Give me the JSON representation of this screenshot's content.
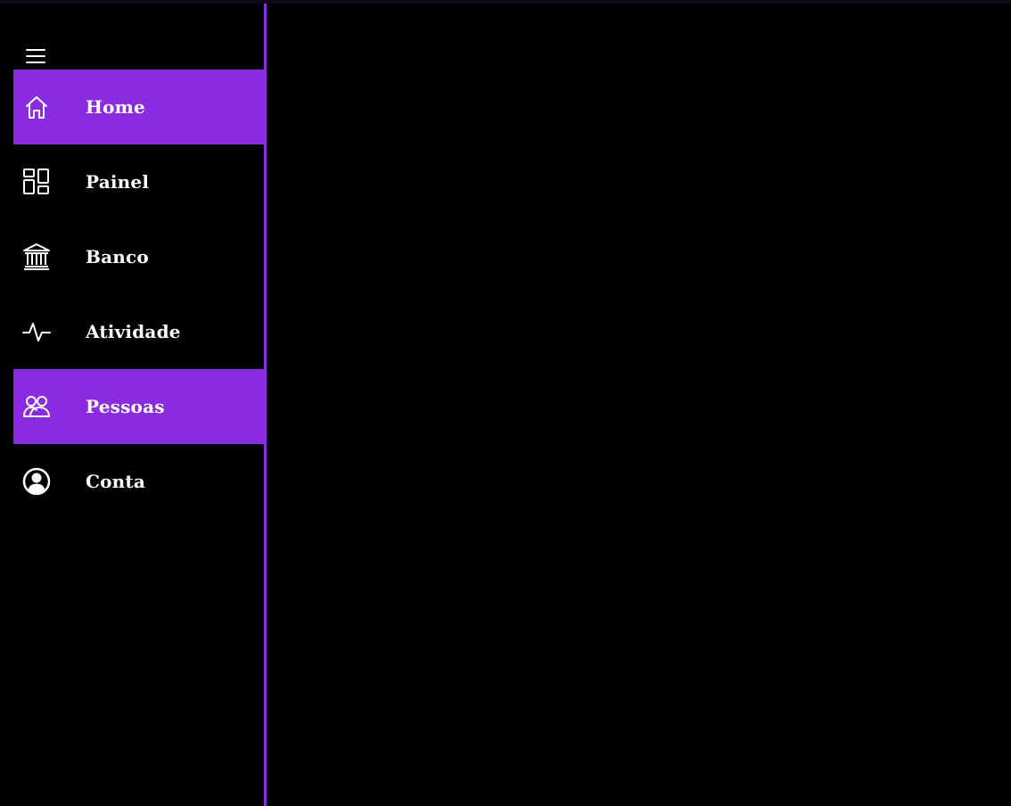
{
  "colors": {
    "accent": "#8a2be2",
    "background": "#000000",
    "text": "#ffffff"
  },
  "menu_toggle": {
    "icon": "hamburger-menu-icon"
  },
  "sidebar": {
    "items": [
      {
        "label": "Home",
        "icon": "home-icon",
        "active": true
      },
      {
        "label": "Painel",
        "icon": "dashboard-icon",
        "active": false
      },
      {
        "label": "Banco",
        "icon": "bank-icon",
        "active": false
      },
      {
        "label": "Atividade",
        "icon": "activity-icon",
        "active": false
      },
      {
        "label": "Pessoas",
        "icon": "people-icon",
        "active": true
      },
      {
        "label": "Conta",
        "icon": "account-icon",
        "active": false
      }
    ]
  }
}
